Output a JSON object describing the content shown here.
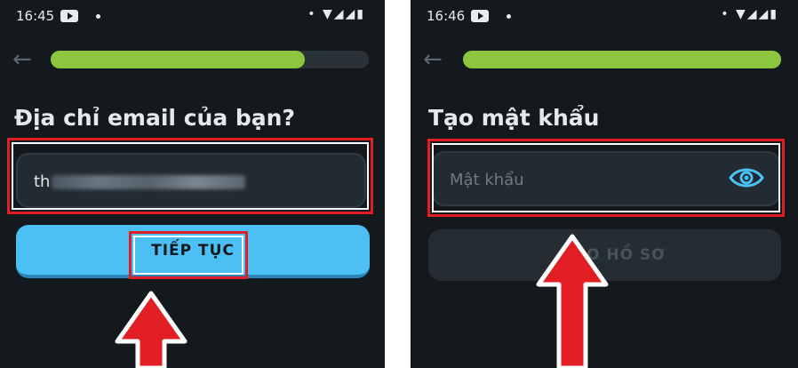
{
  "left": {
    "status": {
      "time": "16:45"
    },
    "progress": 0.8,
    "heading": "Địa chỉ email của bạn?",
    "email": {
      "value_prefix": "th"
    },
    "continue_button": "TIẾP TỤC"
  },
  "right": {
    "status": {
      "time": "16:46"
    },
    "progress": 1.0,
    "heading": "Tạo mật khẩu",
    "password": {
      "placeholder": "Mật khẩu"
    },
    "create_button": "O HỒ SƠ"
  },
  "colors": {
    "accent": "#4cc0f5",
    "progress": "#8cc63f",
    "highlight": "#e01e24",
    "background": "#14191d"
  },
  "icons": {
    "back": "arrow-left-icon",
    "youtube": "youtube-icon",
    "eye": "eye-icon",
    "signal": "signal-icon",
    "battery": "battery-icon"
  }
}
